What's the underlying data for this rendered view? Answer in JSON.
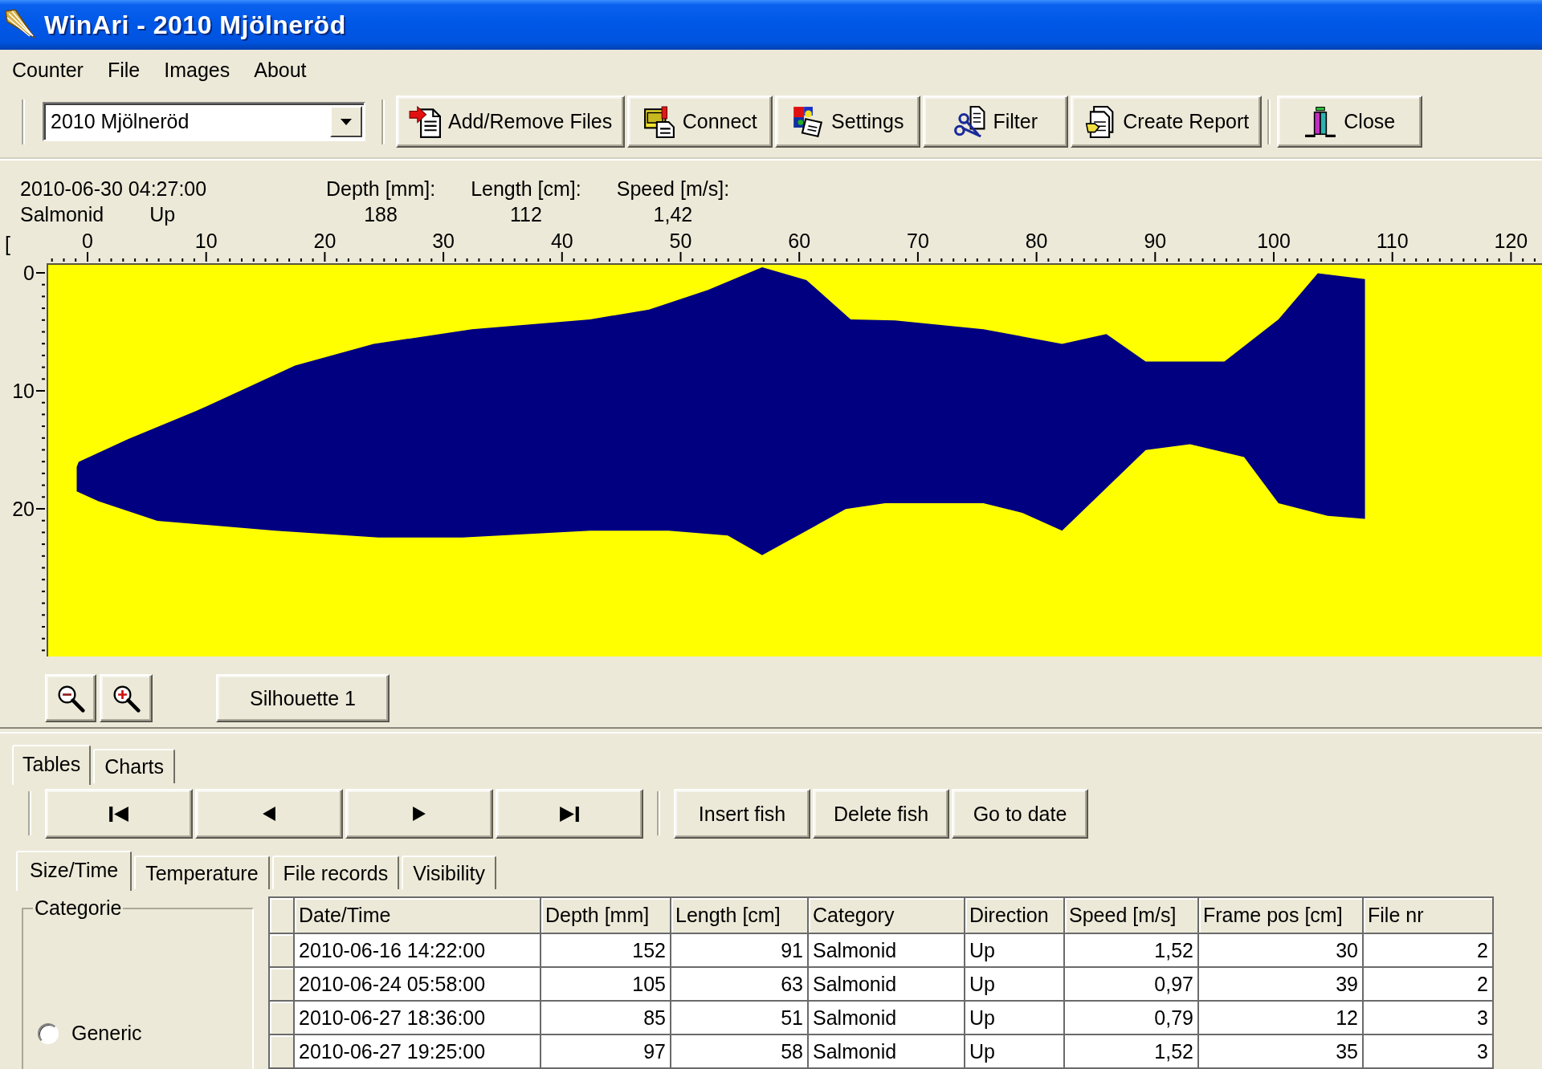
{
  "window": {
    "title": "WinAri - 2010 Mjölneröd"
  },
  "menu": [
    "Counter",
    "File",
    "Images",
    "About"
  ],
  "toolbar": {
    "site_select": {
      "value": "2010 Mjölneröd"
    },
    "button_groups": [
      {
        "buttons": [
          {
            "kind": "files",
            "label": "Add/Remove Files"
          },
          {
            "kind": "connect",
            "label": "Connect"
          },
          {
            "kind": "settings",
            "label": "Settings"
          },
          {
            "kind": "filter",
            "label": "Filter"
          },
          {
            "kind": "report",
            "label": "Create Report"
          }
        ]
      },
      {
        "buttons": [
          {
            "kind": "close",
            "label": "Close"
          }
        ]
      }
    ]
  },
  "current_fish": {
    "timestamp": "2010-06-30 04:27:00",
    "category": "Salmonid",
    "direction": "Up",
    "measurements": [
      {
        "label": "Depth [mm]:",
        "value": "188"
      },
      {
        "label": "Length [cm]:",
        "value": "112"
      },
      {
        "label": "Speed [m/s]:",
        "value": "1,42"
      }
    ]
  },
  "silhouette_view": {
    "corner_mark": "[",
    "x_ruler": [
      "0",
      "10",
      "20",
      "30",
      "40",
      "50",
      "60",
      "70",
      "80",
      "90",
      "100",
      "110",
      "120"
    ],
    "y_ruler": [
      "0",
      "10",
      "20"
    ],
    "silhouette_button": "Silhouette 1"
  },
  "bottom_tabs": [
    {
      "label": "Tables",
      "selected": true
    },
    {
      "label": "Charts",
      "selected": false
    }
  ],
  "record_actions": [
    "Insert fish",
    "Delete fish",
    "Go to date"
  ],
  "sub_tabs": [
    {
      "label": "Size/Time",
      "selected": true
    },
    {
      "label": "Temperature",
      "selected": false
    },
    {
      "label": "File records",
      "selected": false
    },
    {
      "label": "Visibility",
      "selected": false
    }
  ],
  "category_group": {
    "title": "Categorie",
    "options": [
      {
        "label": "Generic",
        "selected": false
      }
    ]
  },
  "table": {
    "columns": [
      {
        "label": "Date/Time",
        "kind": "text"
      },
      {
        "label": "Depth [mm]",
        "kind": "number"
      },
      {
        "label": "Length [cm]",
        "kind": "number"
      },
      {
        "label": "Category",
        "kind": "text"
      },
      {
        "label": "Direction",
        "kind": "text"
      },
      {
        "label": "Speed [m/s]",
        "kind": "number"
      },
      {
        "label": "Frame pos [cm]",
        "kind": "number"
      },
      {
        "label": "File nr",
        "kind": "number"
      }
    ],
    "rows": [
      {
        "selected": false,
        "cells": [
          "2010-06-16 14:22:00",
          "152",
          "91",
          "Salmonid",
          "Up",
          "1,52",
          "30",
          "2"
        ]
      },
      {
        "selected": false,
        "cells": [
          "2010-06-24 05:58:00",
          "105",
          "63",
          "Salmonid",
          "Up",
          "0,97",
          "39",
          "2"
        ]
      },
      {
        "selected": false,
        "cells": [
          "2010-06-27 18:36:00",
          "85",
          "51",
          "Salmonid",
          "Up",
          "0,79",
          "12",
          "3"
        ]
      },
      {
        "selected": false,
        "cells": [
          "2010-06-27 19:25:00",
          "97",
          "58",
          "Salmonid",
          "Up",
          "1,52",
          "35",
          "3"
        ]
      }
    ]
  }
}
